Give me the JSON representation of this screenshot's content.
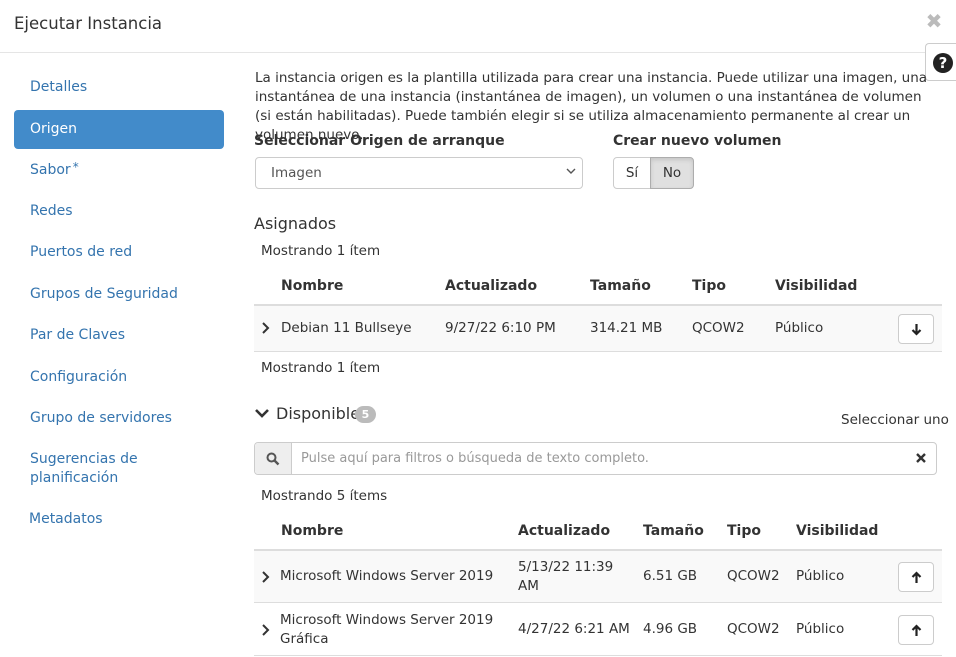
{
  "modal": {
    "title": "Ejecutar Instancia",
    "close_symbol": "✖",
    "help_symbol": "?"
  },
  "sidebar": {
    "items": [
      {
        "label": "Detalles"
      },
      {
        "label": "Origen"
      },
      {
        "label": "Sabor",
        "required_mark": "*"
      },
      {
        "label": "Redes"
      },
      {
        "label": "Puertos de red"
      },
      {
        "label": "Grupos de Seguridad"
      },
      {
        "label": "Par de Claves"
      },
      {
        "label": "Configuración"
      },
      {
        "label": "Grupo de servidores"
      },
      {
        "label": "Sugerencias de planificación"
      },
      {
        "label": "Metadatos"
      }
    ],
    "active_item": "Origen",
    "colors": {
      "active_bg": "#428bca",
      "link": "#3474ae"
    }
  },
  "source": {
    "description": "La instancia origen es la plantilla utilizada para crear una instancia. Puede utilizar una imagen, una instantánea de una instancia (instantánea de imagen), un volumen o una instantánea de volumen (si están habilitadas). Puede también elegir si se utiliza almacenamiento permanente al crear un volumen nuevo.",
    "boot_source_label": "Seleccionar Origen de arranque",
    "boot_source_value": "Imagen",
    "create_volume_label": "Crear nuevo volumen",
    "create_volume_yes": "Sí",
    "create_volume_no": "No",
    "create_volume_selected": "No"
  },
  "allocated": {
    "title": "Asignados",
    "count_top": "Mostrando 1 ítem",
    "count_bottom": "Mostrando 1 ítem",
    "headers": [
      "Nombre",
      "Actualizado",
      "Tamaño",
      "Tipo",
      "Visibilidad"
    ],
    "rows": [
      {
        "name": "Debian 11 Bullseye",
        "updated": "9/27/22 6:10 PM",
        "size": "314.21 MB",
        "type": "QCOW2",
        "visibility": "Público",
        "action_icon": "arrow-down-icon"
      }
    ]
  },
  "available": {
    "title": "Disponible",
    "badge": "5",
    "select_hint": "Seleccionar uno",
    "filter_placeholder": "Pulse aquí para filtros o búsqueda de texto completo.",
    "filter_value": "",
    "count": "Mostrando 5 ítems",
    "headers": [
      "Nombre",
      "Actualizado",
      "Tamaño",
      "Tipo",
      "Visibilidad"
    ],
    "rows": [
      {
        "name": "Microsoft Windows Server 2019",
        "updated": "5/13/22 11:39 AM",
        "size": "6.51 GB",
        "type": "QCOW2",
        "visibility": "Público",
        "action_icon": "arrow-up-icon"
      },
      {
        "name": "Microsoft Windows Server 2019 Gráfica",
        "updated": "4/27/22 6:21 AM",
        "size": "4.96 GB",
        "type": "QCOW2",
        "visibility": "Público",
        "action_icon": "arrow-up-icon"
      }
    ]
  }
}
